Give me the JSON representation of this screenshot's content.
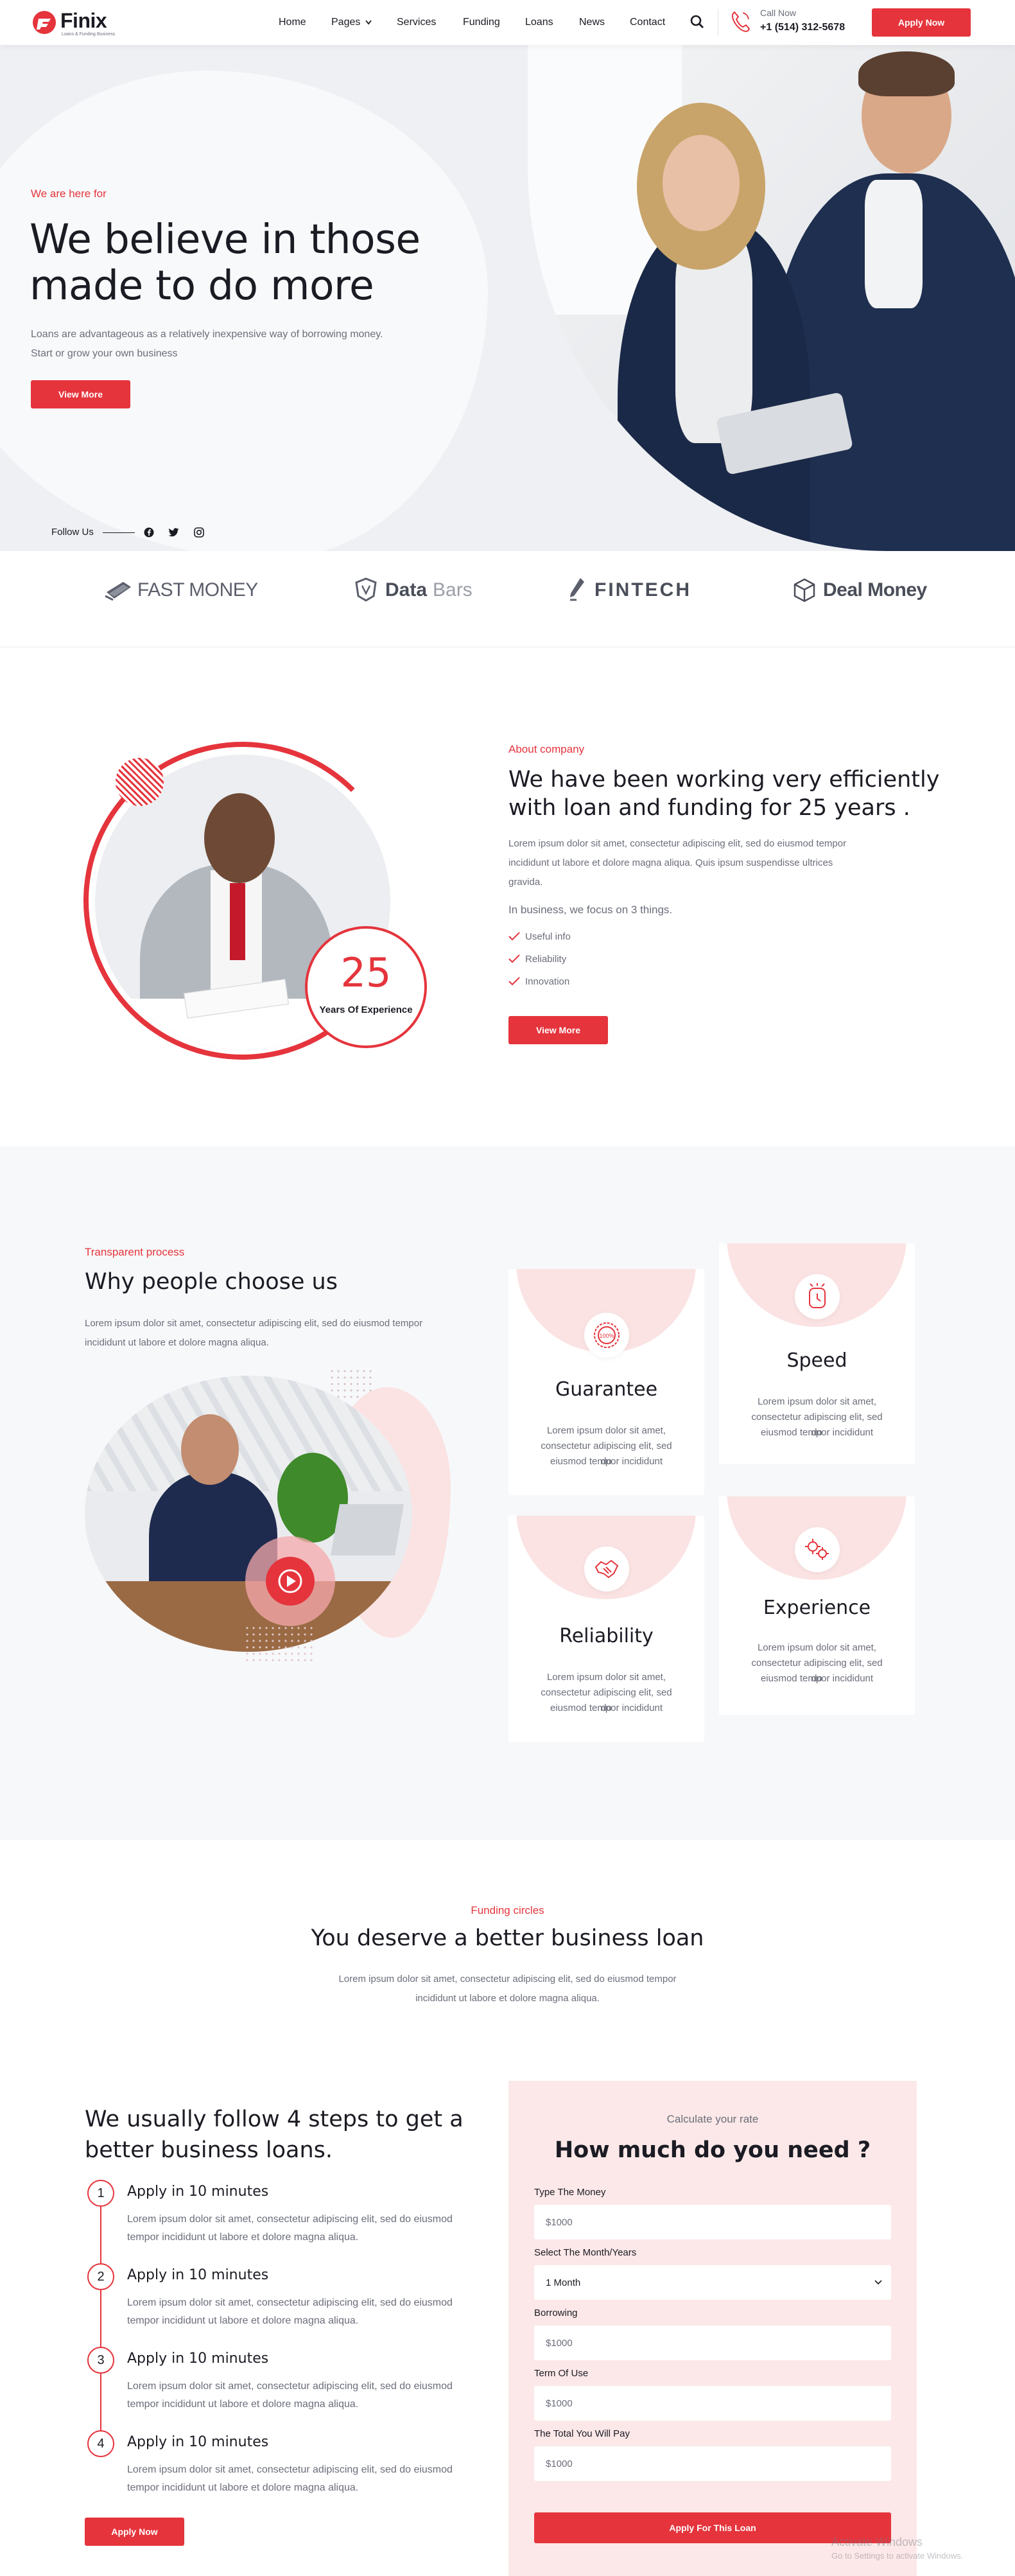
{
  "brand": {
    "name": "Finix",
    "tagline": "Loans & Funding Business",
    "accent": "#e5343c"
  },
  "nav": {
    "items": [
      "Home",
      "Pages",
      "Services",
      "Funding",
      "Loans",
      "News",
      "Contact"
    ],
    "call_label": "Call Now",
    "phone": "+1 (514) 312-5678",
    "apply_label": "Apply Now",
    "icons": {
      "search": "search-icon",
      "phone": "phone-icon",
      "dropdown": "chevron-down-icon"
    }
  },
  "hero": {
    "eyebrow": "We are here for",
    "title_line1": "We believe in those",
    "title_line2": "made to do more",
    "desc_line1": "Loans are advantageous as a relatively inexpensive way of borrowing money.",
    "desc_line2": "Start or grow your own business",
    "button": "View More",
    "follow_label": "Follow Us",
    "social_icons": [
      "facebook-icon",
      "twitter-icon",
      "instagram-icon"
    ]
  },
  "partners": [
    {
      "name": "FAST MONEY",
      "icon": "money-icon"
    },
    {
      "name1": "Data",
      "name2": "Bars",
      "icon": "shield-icon"
    },
    {
      "name": "FINTECH",
      "icon": "pen-icon"
    },
    {
      "name": "Deal Money",
      "icon": "box-icon"
    }
  ],
  "about": {
    "eyebrow": "About company",
    "title_line1": "We have been working very efficiently",
    "title_line2": "with loan and funding for 25 years .",
    "desc_line1": "Lorem ipsum dolor sit amet, consectetur adipiscing elit, sed do eiusmod tempor",
    "desc_line2": "incididunt ut labore et dolore magna aliqua. Quis ipsum suspendisse ultrices",
    "desc_line3": "gravida.",
    "focus": "In business, we focus on 3 things.",
    "checks": [
      "Useful info",
      "Reliability",
      "Innovation"
    ],
    "button": "View More",
    "years": "25",
    "years_label": "Years Of Experience"
  },
  "why": {
    "eyebrow": "Transparent process",
    "title": "Why people choose us",
    "desc_line1": "Lorem ipsum dolor sit amet, consectetur adipiscing elit, sed do eiusmod tempor",
    "desc_line2": "incididunt ut labore et dolore magna aliqua.",
    "cards": [
      {
        "title": "Guarantee",
        "icon": "guarantee-badge-icon",
        "l1": "Lorem ipsum dolor sit amet,",
        "l2": "consectetur adipiscing elit, sed do",
        "l3": "eiusmod tempor incididunt"
      },
      {
        "title": "Speed",
        "icon": "speedometer-icon",
        "l1": "Lorem ipsum dolor sit amet,",
        "l2": "consectetur adipiscing elit, sed do",
        "l3": "eiusmod tempor incididunt"
      },
      {
        "title": "Reliability",
        "icon": "handshake-icon",
        "l1": "Lorem ipsum dolor sit amet,",
        "l2": "consectetur adipiscing elit, sed do",
        "l3": "eiusmod tempor incididunt"
      },
      {
        "title": "Experience",
        "icon": "gears-icon",
        "l1": "Lorem ipsum dolor sit amet,",
        "l2": "consectetur adipiscing elit, sed do",
        "l3": "eiusmod tempor incididunt"
      }
    ],
    "video_icon": "play-icon"
  },
  "funding": {
    "eyebrow": "Funding circles",
    "title": "You deserve a better business loan",
    "desc_line1": "Lorem ipsum dolor sit amet, consectetur adipiscing elit, sed do eiusmod tempor",
    "desc_line2": "incididunt ut labore et dolore magna aliqua."
  },
  "steps": {
    "title_line1": "We usually follow 4 steps to get a",
    "title_line2": "better business loans.",
    "items": [
      {
        "num": "1",
        "title": "Apply in 10 minutes",
        "l1": "Lorem ipsum dolor sit amet, consectetur adipiscing elit, sed do eiusmod",
        "l2": "tempor incididunt ut labore et dolore magna aliqua."
      },
      {
        "num": "2",
        "title": "Apply in 10 minutes",
        "l1": "Lorem ipsum dolor sit amet, consectetur adipiscing elit, sed do eiusmod",
        "l2": "tempor incididunt ut labore et dolore magna aliqua."
      },
      {
        "num": "3",
        "title": "Apply in 10 minutes",
        "l1": "Lorem ipsum dolor sit amet, consectetur adipiscing elit, sed do eiusmod",
        "l2": "tempor incididunt ut labore et dolore magna aliqua."
      },
      {
        "num": "4",
        "title": "Apply in 10 minutes",
        "l1": "Lorem ipsum dolor sit amet, consectetur adipiscing elit, sed do eiusmod",
        "l2": "tempor incididunt ut labore et dolore magna aliqua."
      }
    ],
    "button": "Apply Now"
  },
  "calculator": {
    "eyebrow": "Calculate your rate",
    "title": "How much do you need ?",
    "fields": [
      {
        "label": "Type The Money",
        "value": "$1000"
      },
      {
        "label": "Select The Month/Years",
        "value": "1 Month"
      },
      {
        "label": "Borrowing",
        "value": "$1000"
      },
      {
        "label": "Term Of Use",
        "value": "$1000"
      },
      {
        "label": "The Total You Will Pay",
        "value": "$1000"
      }
    ],
    "button": "Apply For This Loan"
  },
  "watermark": {
    "line1": "Activate Windows",
    "line2": "Go to Settings to activate Windows."
  }
}
